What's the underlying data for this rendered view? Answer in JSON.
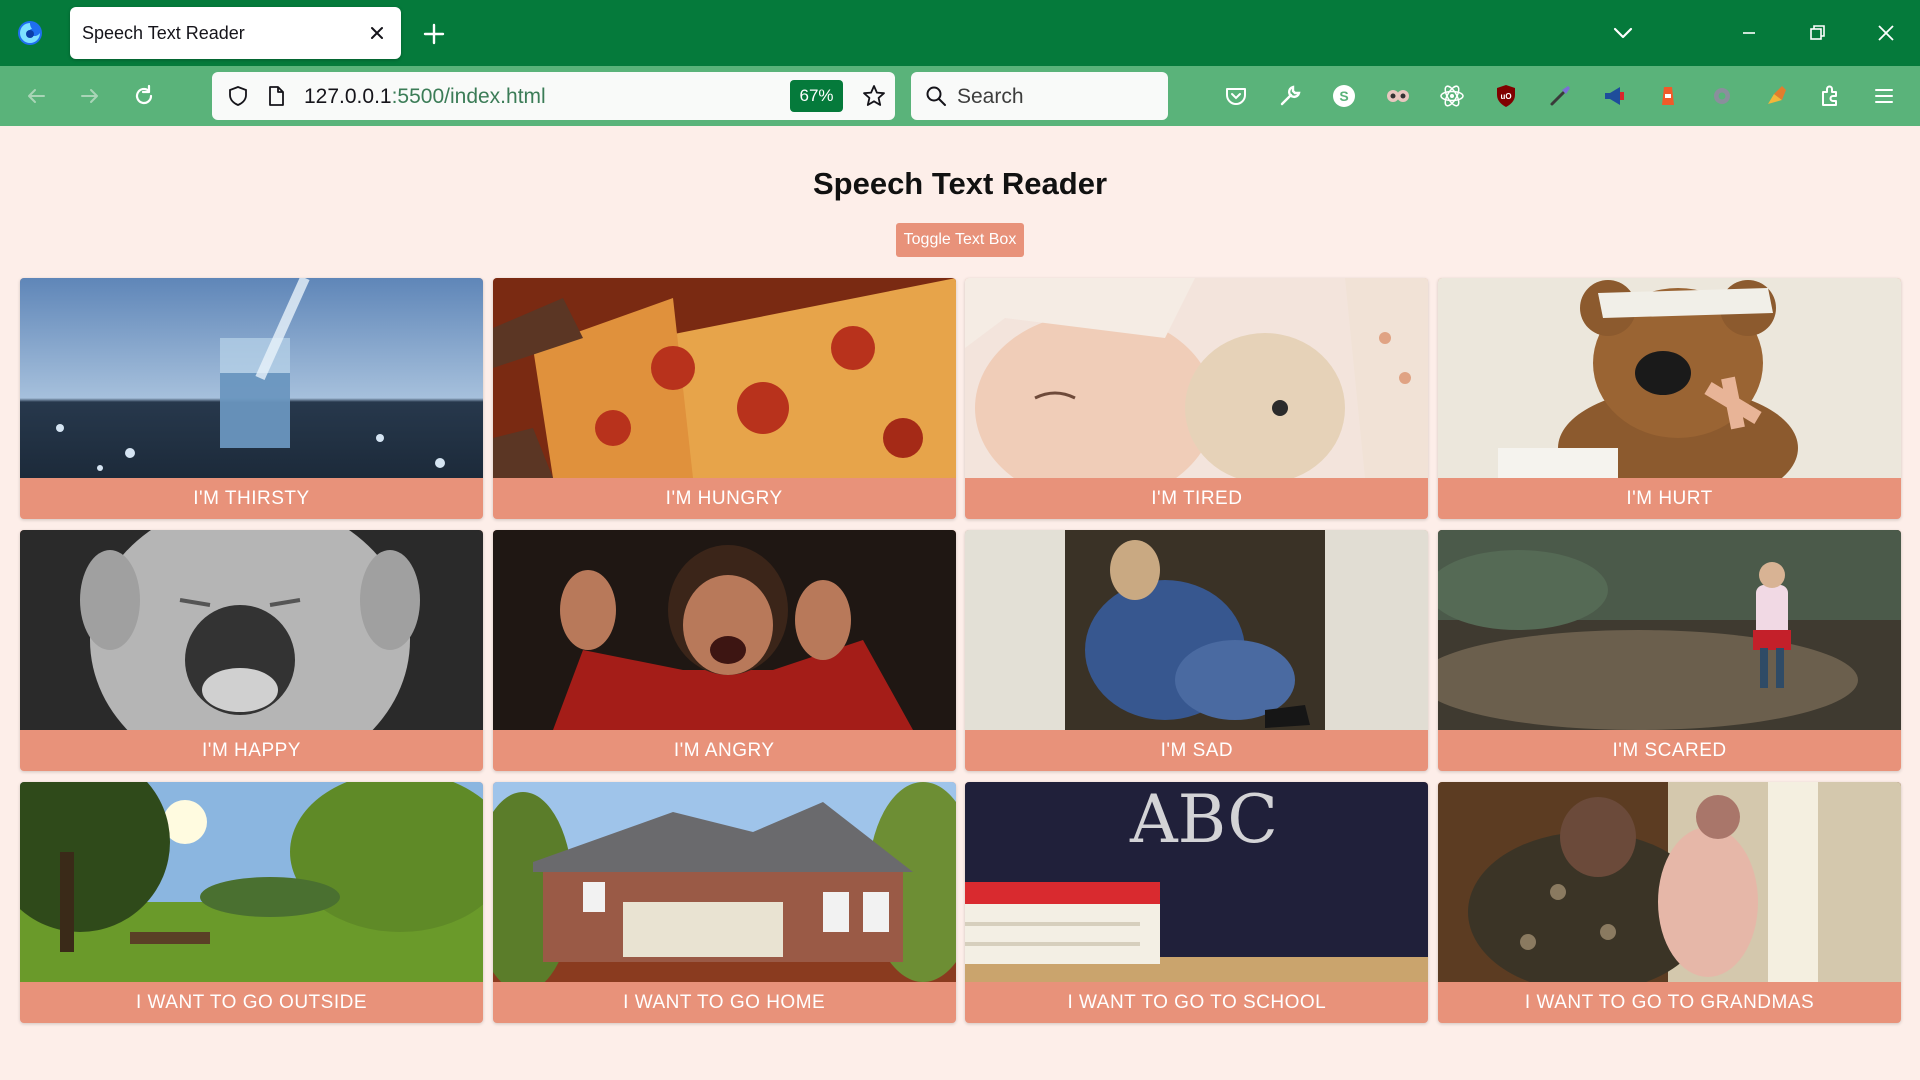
{
  "browser": {
    "tab_title": "Speech Text Reader",
    "url_host": "127.0.0.1",
    "url_path": ":5500/index.html",
    "zoom": "67%",
    "search_placeholder": "Search",
    "accent_color": "#057a3b",
    "toolbar_color": "#5ab37a"
  },
  "page": {
    "title": "Speech Text Reader",
    "toggle_button": "Toggle Text Box",
    "background": "#fdeee9",
    "card_color": "#e8927a"
  },
  "cards": [
    {
      "label": "I'm Thirsty",
      "image": "glass-of-water"
    },
    {
      "label": "I'm Hungry",
      "image": "pizza-slice"
    },
    {
      "label": "I'm Tired",
      "image": "sleeping-child"
    },
    {
      "label": "I'm Hurt",
      "image": "bandaged-teddy-bear"
    },
    {
      "label": "I'm Happy",
      "image": "laughing-child"
    },
    {
      "label": "I'm Angry",
      "image": "angry-child"
    },
    {
      "label": "I'm Sad",
      "image": "sad-child"
    },
    {
      "label": "I'm Scared",
      "image": "child-in-forest"
    },
    {
      "label": "I Want To Go Outside",
      "image": "park"
    },
    {
      "label": "I Want To Go Home",
      "image": "house"
    },
    {
      "label": "I Want To Go To School",
      "image": "chalkboard-books"
    },
    {
      "label": "I Want To Go To Grandmas",
      "image": "grandmother-hug"
    }
  ]
}
